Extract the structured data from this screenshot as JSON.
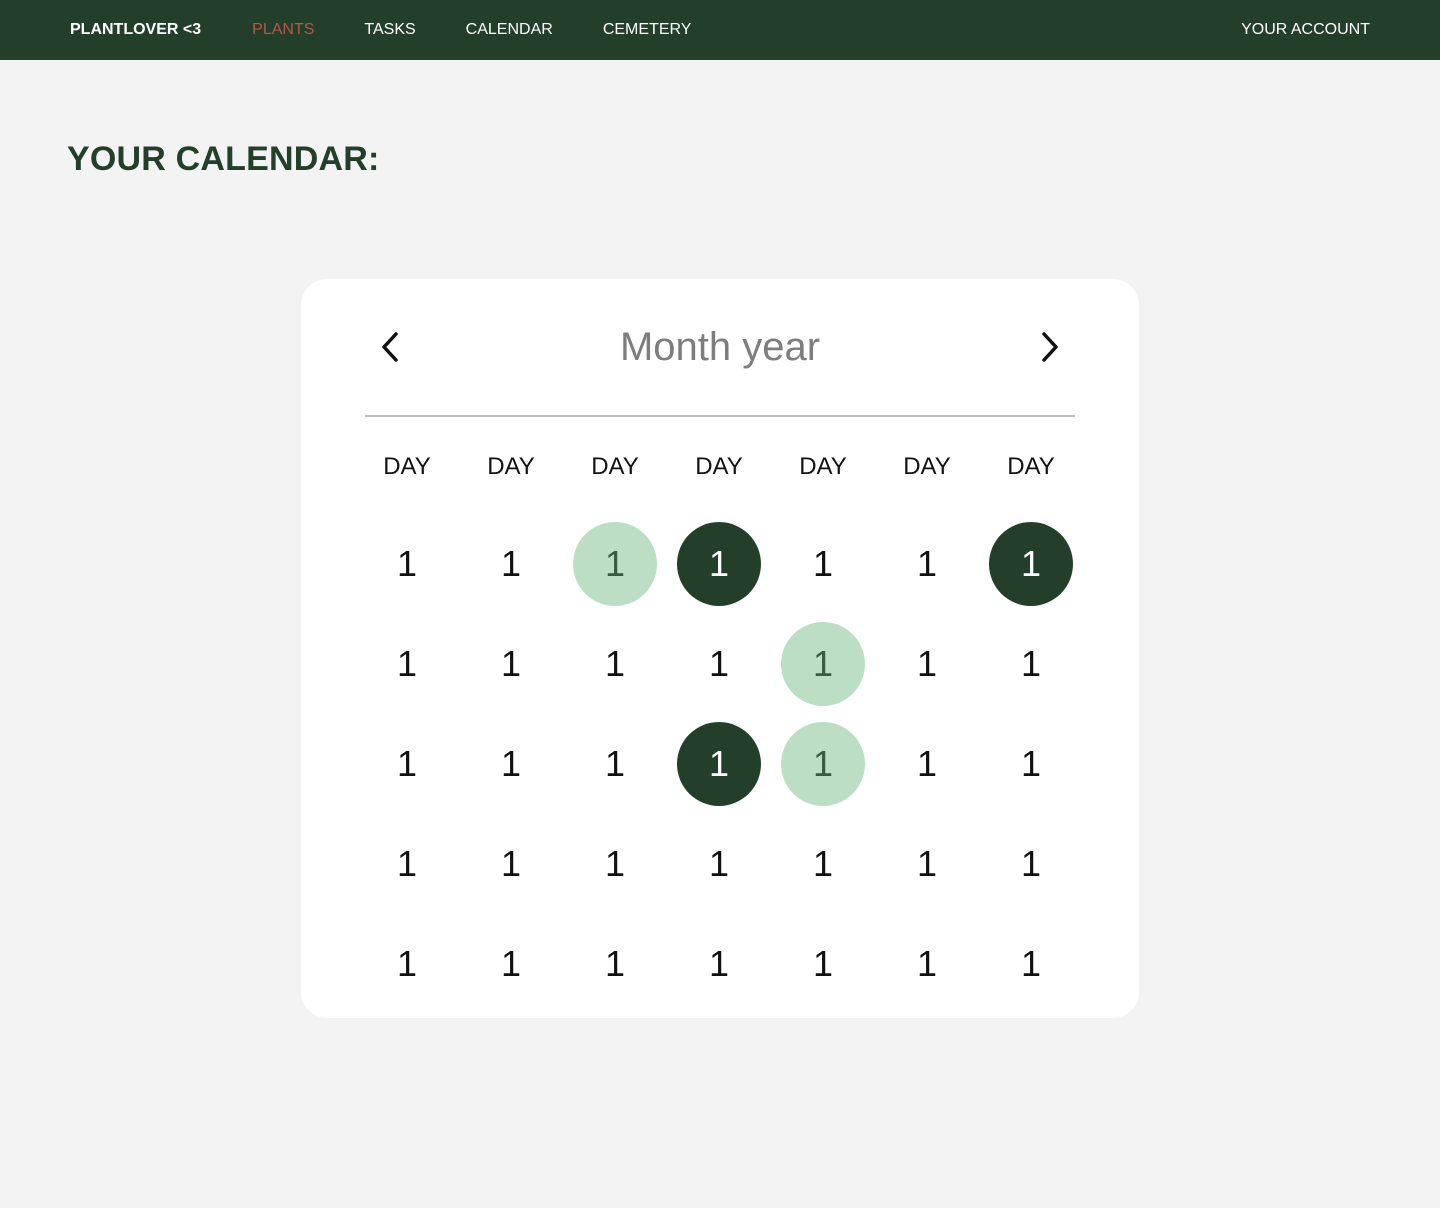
{
  "nav": {
    "brand": "PLANTLOVER <3",
    "items": [
      {
        "label": "PLANTS",
        "active": true
      },
      {
        "label": "TASKS",
        "active": false
      },
      {
        "label": "CALENDAR",
        "active": false
      },
      {
        "label": "CEMETERY",
        "active": false
      }
    ],
    "account": "YOUR ACCOUNT"
  },
  "colors": {
    "nav_bg": "#233f2a",
    "active_link": "#b5574a",
    "highlight_light": "#bcdec5",
    "highlight_dark": "#233f2a",
    "page_bg": "#f3f3f3"
  },
  "page": {
    "title": "YOUR CALENDAR:"
  },
  "calendar": {
    "month_label": "Month year",
    "prev_icon": "chevron-left-icon",
    "next_icon": "chevron-right-icon",
    "weekdays": [
      "DAY",
      "DAY",
      "DAY",
      "DAY",
      "DAY",
      "DAY",
      "DAY"
    ],
    "weeks": [
      [
        {
          "label": "1",
          "mark": "none"
        },
        {
          "label": "1",
          "mark": "none"
        },
        {
          "label": "1",
          "mark": "light"
        },
        {
          "label": "1",
          "mark": "dark"
        },
        {
          "label": "1",
          "mark": "none"
        },
        {
          "label": "1",
          "mark": "none"
        },
        {
          "label": "1",
          "mark": "dark"
        }
      ],
      [
        {
          "label": "1",
          "mark": "none"
        },
        {
          "label": "1",
          "mark": "none"
        },
        {
          "label": "1",
          "mark": "none"
        },
        {
          "label": "1",
          "mark": "none"
        },
        {
          "label": "1",
          "mark": "light"
        },
        {
          "label": "1",
          "mark": "none"
        },
        {
          "label": "1",
          "mark": "none"
        }
      ],
      [
        {
          "label": "1",
          "mark": "none"
        },
        {
          "label": "1",
          "mark": "none"
        },
        {
          "label": "1",
          "mark": "none"
        },
        {
          "label": "1",
          "mark": "dark"
        },
        {
          "label": "1",
          "mark": "light"
        },
        {
          "label": "1",
          "mark": "none"
        },
        {
          "label": "1",
          "mark": "none"
        }
      ],
      [
        {
          "label": "1",
          "mark": "none"
        },
        {
          "label": "1",
          "mark": "none"
        },
        {
          "label": "1",
          "mark": "none"
        },
        {
          "label": "1",
          "mark": "none"
        },
        {
          "label": "1",
          "mark": "none"
        },
        {
          "label": "1",
          "mark": "none"
        },
        {
          "label": "1",
          "mark": "none"
        }
      ],
      [
        {
          "label": "1",
          "mark": "none"
        },
        {
          "label": "1",
          "mark": "none"
        },
        {
          "label": "1",
          "mark": "none"
        },
        {
          "label": "1",
          "mark": "none"
        },
        {
          "label": "1",
          "mark": "none"
        },
        {
          "label": "1",
          "mark": "none"
        },
        {
          "label": "1",
          "mark": "none"
        }
      ]
    ]
  }
}
